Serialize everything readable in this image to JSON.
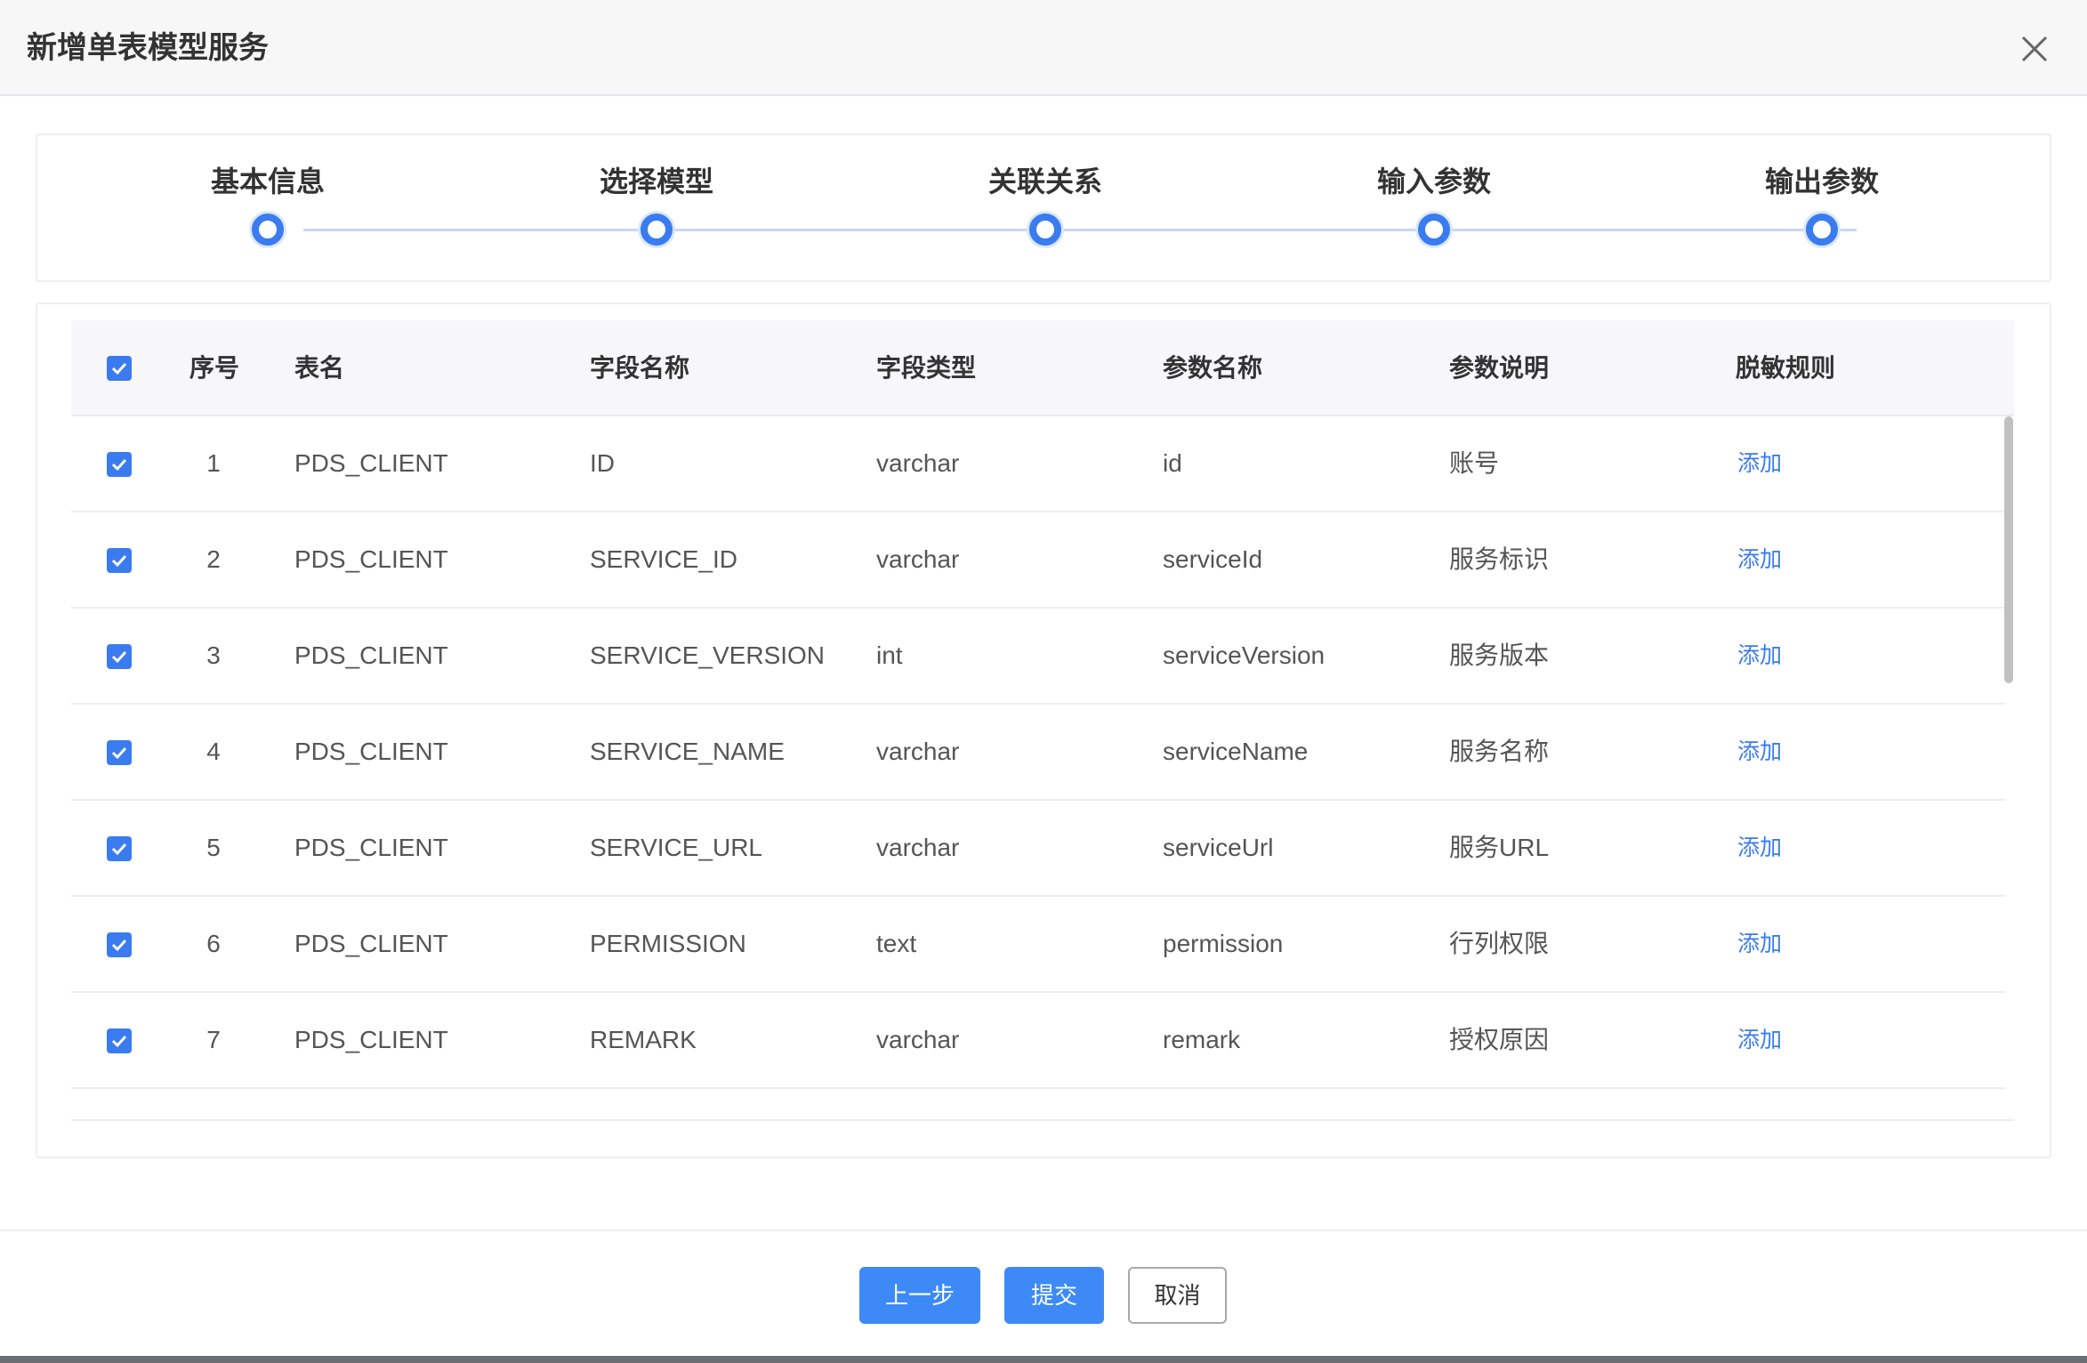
{
  "modal": {
    "title": "新增单表模型服务"
  },
  "steps": [
    {
      "label": "基本信息"
    },
    {
      "label": "选择模型"
    },
    {
      "label": "关联关系"
    },
    {
      "label": "输入参数"
    },
    {
      "label": "输出参数"
    }
  ],
  "table": {
    "columns": [
      "序号",
      "表名",
      "字段名称",
      "字段类型",
      "参数名称",
      "参数说明",
      "脱敏规则"
    ],
    "rows": [
      {
        "index": "1",
        "table": "PDS_CLIENT",
        "field": "ID",
        "type": "varchar",
        "param": "id",
        "desc": "账号",
        "action": "添加",
        "checked": true
      },
      {
        "index": "2",
        "table": "PDS_CLIENT",
        "field": "SERVICE_ID",
        "type": "varchar",
        "param": "serviceId",
        "desc": "服务标识",
        "action": "添加",
        "checked": true
      },
      {
        "index": "3",
        "table": "PDS_CLIENT",
        "field": "SERVICE_VERSION",
        "type": "int",
        "param": "serviceVersion",
        "desc": "服务版本",
        "action": "添加",
        "checked": true
      },
      {
        "index": "4",
        "table": "PDS_CLIENT",
        "field": "SERVICE_NAME",
        "type": "varchar",
        "param": "serviceName",
        "desc": "服务名称",
        "action": "添加",
        "checked": true
      },
      {
        "index": "5",
        "table": "PDS_CLIENT",
        "field": "SERVICE_URL",
        "type": "varchar",
        "param": "serviceUrl",
        "desc": "服务URL",
        "action": "添加",
        "checked": true
      },
      {
        "index": "6",
        "table": "PDS_CLIENT",
        "field": "PERMISSION",
        "type": "text",
        "param": "permission",
        "desc": "行列权限",
        "action": "添加",
        "checked": true
      },
      {
        "index": "7",
        "table": "PDS_CLIENT",
        "field": "REMARK",
        "type": "varchar",
        "param": "remark",
        "desc": "授权原因",
        "action": "添加",
        "checked": true
      }
    ]
  },
  "footer": {
    "prev_label": "上一步",
    "submit_label": "提交",
    "cancel_label": "取消"
  },
  "icons": {
    "close": "close-icon",
    "checkbox": "check-icon"
  },
  "colors": {
    "accent": "#3a7bf0",
    "button": "#3d8af7",
    "link": "#3a7bf0"
  }
}
